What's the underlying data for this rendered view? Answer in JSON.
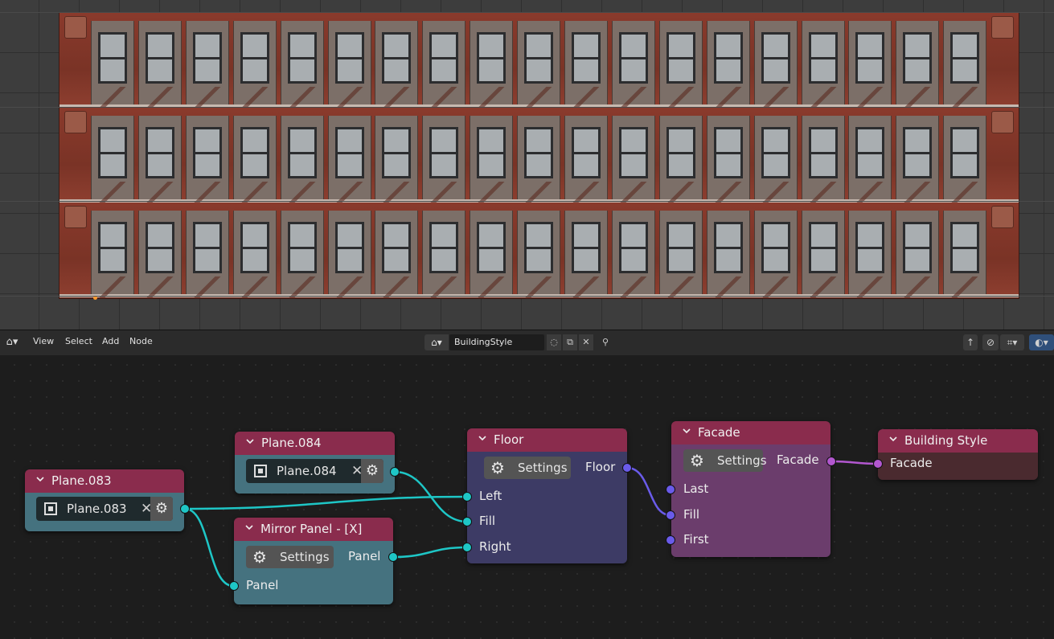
{
  "header": {
    "menus": [
      "View",
      "Select",
      "Add",
      "Node"
    ],
    "tree_name": "BuildingStyle"
  },
  "nodes": {
    "plane083": {
      "title": "Plane.083",
      "object": "Plane.083"
    },
    "plane084": {
      "title": "Plane.084",
      "object": "Plane.084"
    },
    "mirror": {
      "title": "Mirror Panel - [X]",
      "settings": "Settings",
      "out": "Panel",
      "in": "Panel"
    },
    "floor": {
      "title": "Floor",
      "settings": "Settings",
      "out": "Floor",
      "in_left": "Left",
      "in_fill": "Fill",
      "in_right": "Right"
    },
    "facade": {
      "title": "Facade",
      "settings": "Settings",
      "out": "Facade",
      "in_last": "Last",
      "in_fill": "Fill",
      "in_first": "First"
    },
    "building_style": {
      "title": "Building Style",
      "in": "Facade"
    }
  },
  "colors": {
    "node_header": "#8a2c4d",
    "teal_node": "#45727f",
    "navy_node": "#3d3b65",
    "purple_node": "#6b3d6c",
    "link_teal": "#1ec6c6",
    "link_blue": "#6a5bea",
    "link_purple": "#b257cf"
  }
}
